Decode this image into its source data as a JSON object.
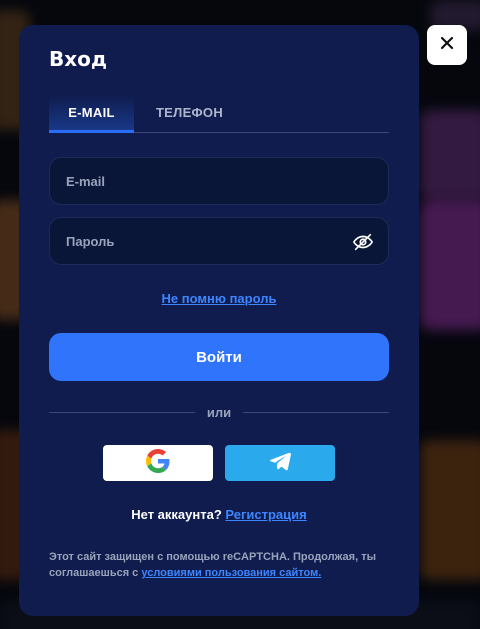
{
  "modal": {
    "title": "Вход",
    "tabs": [
      {
        "label": "E-MAIL",
        "active": true
      },
      {
        "label": "ТЕЛЕФОН",
        "active": false
      }
    ],
    "email_field": {
      "placeholder": "E-mail",
      "value": ""
    },
    "password_field": {
      "placeholder": "Пароль",
      "value": ""
    },
    "forgot_link": "Не помню пароль",
    "submit_label": "Войти",
    "divider_text": "или",
    "social": [
      {
        "name": "google-icon"
      },
      {
        "name": "telegram-icon"
      }
    ],
    "register": {
      "prompt": "Нет аккаунта?",
      "link": "Регистрация"
    },
    "legal": {
      "text": "Этот сайт защищен с помощью reCAPTCHA. Продолжая, ты соглашаешься с",
      "link": "условиями пользования сайтом."
    }
  },
  "close_icon": "close-icon",
  "colors": {
    "modal_bg": "#0f1c4d",
    "accent": "#2f74fb",
    "link": "#3d86ff",
    "telegram": "#2aa9ec"
  }
}
